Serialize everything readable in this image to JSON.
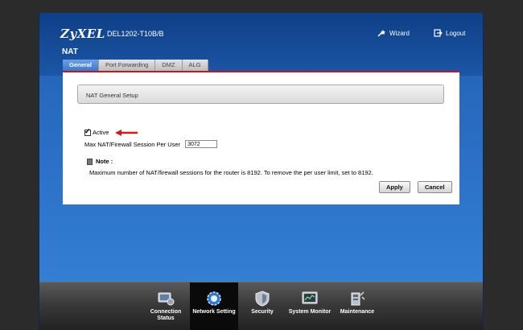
{
  "header": {
    "logo": "ZyXEL",
    "model": "DEL1202-T10B/B",
    "page_title": "NAT",
    "wizard_label": "Wizard",
    "logout_label": "Logout"
  },
  "tabs": [
    {
      "label": "General",
      "active": true
    },
    {
      "label": "Port Forwarding",
      "active": false
    },
    {
      "label": "DMZ",
      "active": false
    },
    {
      "label": "ALG",
      "active": false
    }
  ],
  "form": {
    "section_title": "NAT General Setup",
    "active_label": "Active",
    "active_checked": true,
    "session_label": "Max NAT/Firewall Session Per User",
    "session_value": "3072",
    "note_title": "Note :",
    "note_text": "Maximum number of NAT/firewall sessions for the router is 8192.  To remove the per user limit, set to 8192.",
    "apply_label": "Apply",
    "cancel_label": "Cancel"
  },
  "bottom_nav": [
    {
      "label": "Connection Status",
      "icon": "monitor-icon",
      "active": false
    },
    {
      "label": "Network Setting",
      "icon": "gear-icon",
      "active": true
    },
    {
      "label": "Security",
      "icon": "shield-icon",
      "active": false
    },
    {
      "label": "System Monitor",
      "icon": "chart-icon",
      "active": false
    },
    {
      "label": "Maintenance",
      "icon": "tools-icon",
      "active": false
    }
  ],
  "colors": {
    "accent_red": "#c4161c",
    "header_blue": "#0f3f87",
    "tab_active": "#3c78c9"
  }
}
